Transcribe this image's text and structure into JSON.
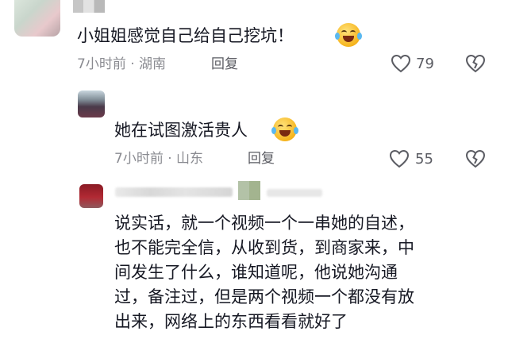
{
  "comments": [
    {
      "text": "小姐姐感觉自己给自己挖坑！",
      "meta": "7小时前 · 湖南",
      "reply_label": "回复",
      "like_count": "79"
    },
    {
      "text": "她在试图激活贵人",
      "meta": "7小时前 · 山东",
      "reply_label": "回复",
      "like_count": "55"
    },
    {
      "lines": [
        "说实话，就一个视频一个一串她的自述，",
        "也不能完全信，从收到货，到商家来，中",
        "间发生了什么，谁知道呢，他说她沟通",
        "过，备注过，但是两个视频一个都没有放",
        "出来，网络上的东西看看就好了"
      ]
    }
  ],
  "icons": {
    "emoji": "laughing-tears-emoji-icon",
    "like": "heart-outline-icon",
    "dislike": "broken-heart-icon"
  }
}
